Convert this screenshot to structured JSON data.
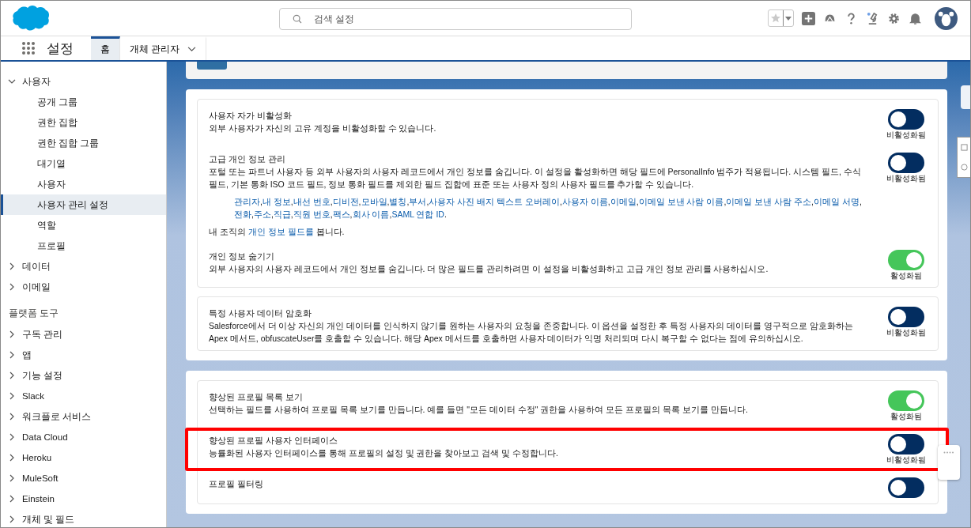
{
  "header": {
    "search": {
      "placeholder": "검색 설정"
    }
  },
  "nav": {
    "app_title": "설정",
    "tabs": [
      {
        "label": "홈",
        "selected": true,
        "dropdown": false
      },
      {
        "label": "개체 관리자",
        "selected": false,
        "dropdown": true
      }
    ]
  },
  "sidebar": {
    "sections": [
      {
        "items": [
          {
            "label": "사용자",
            "expanded": true,
            "children": [
              {
                "label": "공개 그룹",
                "selected": false
              },
              {
                "label": "권한 집합",
                "selected": false
              },
              {
                "label": "권한 집합 그룹",
                "selected": false
              },
              {
                "label": "대기열",
                "selected": false
              },
              {
                "label": "사용자",
                "selected": false
              },
              {
                "label": "사용자 관리 설정",
                "selected": true
              },
              {
                "label": "역할",
                "selected": false
              },
              {
                "label": "프로필",
                "selected": false
              }
            ]
          },
          {
            "label": "데이터",
            "expanded": false
          },
          {
            "label": "이메일",
            "expanded": false
          }
        ]
      },
      {
        "heading": "플랫폼 도구",
        "items": [
          {
            "label": "구독 관리",
            "expanded": false
          },
          {
            "label": "앱",
            "expanded": false
          },
          {
            "label": "기능 설정",
            "expanded": false
          },
          {
            "label": "Slack",
            "expanded": false
          },
          {
            "label": "워크플로 서비스",
            "expanded": false
          },
          {
            "label": "Data Cloud",
            "expanded": false
          },
          {
            "label": "Heroku",
            "expanded": false
          },
          {
            "label": "MuleSoft",
            "expanded": false
          },
          {
            "label": "Einstein",
            "expanded": false
          },
          {
            "label": "개체 및 필드",
            "expanded": false
          }
        ]
      }
    ]
  },
  "cards": [
    {
      "boxes": [
        {
          "settings": [
            {
              "title": "사용자 자가 비활성화",
              "description": "외부 사용자가 자신의 고유 계정을 비활성화할 수 있습니다.",
              "toggle": {
                "on": false,
                "label": "비활성화됨"
              },
              "highlighted": false
            },
            {
              "title": "고급 개인 정보 관리",
              "description": "포털 또는 파트너 사용자 등 외부 사용자의 사용자 레코드에서 개인 정보를 숨깁니다. 이 설정을 활성화하면 해당 필드에 PersonalInfo 범주가 적용됩니다. 시스템 필드, 수식 필드, 기본 통화 ISO 코드 필드, 정보 통화 필드를 제외한 필드 집합에 표준 또는 사용자 정의 사용자 필드를 추가할 수 있습니다.",
              "links": [
                {
                  "label": "관리자",
                  "sep": ","
                },
                {
                  "label": "내 정보",
                  "sep": ","
                },
                {
                  "label": "내선 번호",
                  "sep": ","
                },
                {
                  "label": "디비전",
                  "sep": ","
                },
                {
                  "label": "모바일",
                  "sep": ","
                },
                {
                  "label": "별칭",
                  "sep": ","
                },
                {
                  "label": "부서",
                  "sep": ","
                },
                {
                  "label": "사용자 사진 배지 텍스트 오버레이",
                  "sep": ","
                },
                {
                  "label": "사용자 이름",
                  "sep": ","
                },
                {
                  "label": "이메일",
                  "sep": ","
                },
                {
                  "label": "이메일 보낸 사람 이름",
                  "sep": ","
                },
                {
                  "label": "이메일 보낸 사람 주소",
                  "sep": ","
                },
                {
                  "label": "이메일 서명",
                  "sep": ","
                },
                {
                  "label": "전화",
                  "sep": ","
                },
                {
                  "label": "주소",
                  "sep": ","
                },
                {
                  "label": "직급",
                  "sep": ","
                },
                {
                  "label": "직원 번호",
                  "sep": ","
                },
                {
                  "label": "팩스",
                  "sep": ","
                },
                {
                  "label": "회사 이름",
                  "sep": ","
                },
                {
                  "label": "SAML 연합 ID",
                  "sep": "."
                }
              ],
              "note": {
                "before": "내 조직의",
                "link": "개인 정보 필드를",
                "after": "봅니다."
              },
              "toggle": {
                "on": false,
                "label": "비활성화됨"
              },
              "highlighted": false
            },
            {
              "title": "개인 정보 숨기기",
              "description": "외부 사용자의 사용자 레코드에서 개인 정보를 숨깁니다. 더 많은 필드를 관리하려면 이 설정을 비활성화하고 고급 개인 정보 관리를 사용하십시오.",
              "toggle": {
                "on": true,
                "label": "활성화됨"
              },
              "highlighted": false
            }
          ]
        },
        {
          "settings": [
            {
              "title": "특정 사용자 데이터 암호화",
              "description": "Salesforce에서 더 이상 자신의 개인 데이터를 인식하지 않기를 원하는 사용자의 요청을 존중합니다. 이 옵션을 설정한 후 특정 사용자의 데이터를 영구적으로 암호화하는 Apex 메서드, obfuscateUser를 호출할 수 있습니다. 해당 Apex 메서드를 호출하면 사용자 데이터가 익명 처리되며 다시 복구할 수 없다는 점에 유의하십시오.",
              "toggle": {
                "on": false,
                "label": "비활성화됨"
              },
              "highlighted": false
            }
          ]
        }
      ]
    },
    {
      "boxes": [
        {
          "settings": [
            {
              "title": "향상된 프로필 목록 보기",
              "description": "선택하는 필드를 사용하여 프로필 목록 보기를 만듭니다. 예를 들면 \"모든 데이터 수정\" 권한을 사용하여 모든 프로필의 목록 보기를 만듭니다.",
              "toggle": {
                "on": true,
                "label": "활성화됨"
              },
              "highlighted": false
            },
            {
              "title": "향상된 프로필 사용자 인터페이스",
              "description": "능률화된 사용자 인터페이스를 통해 프로필의 설정 및 권한을 찾아보고 검색 및 수정합니다.",
              "toggle": {
                "on": false,
                "label": "비활성화됨"
              },
              "highlighted": true
            },
            {
              "title": "프로필 필터링",
              "toggle": {
                "on": false
              },
              "highlighted": false
            }
          ]
        }
      ]
    }
  ]
}
